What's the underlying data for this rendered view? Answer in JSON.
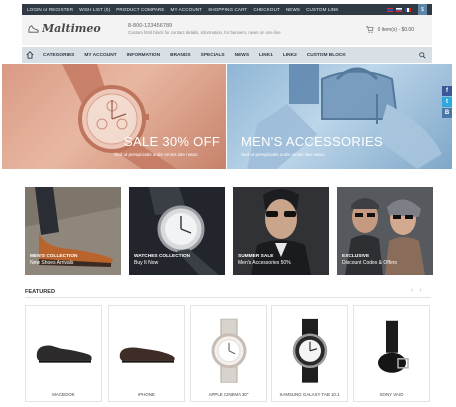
{
  "topbar": {
    "links": [
      "LOGIN or REGISTER",
      "WISH LIST (0)",
      "PRODUCT COMPARE",
      "MY ACCOUNT",
      "SHOPPING CART",
      "CHECKOUT",
      "NEWS",
      "CUSTOM LINK"
    ],
    "currency": "$"
  },
  "header": {
    "logo": "Maltimeo",
    "phone": "8-800-123456789",
    "tagline": "Custom html block for contact details, information, for banners, news on one line",
    "cart": "0 item(s) - $0.00"
  },
  "nav": {
    "items": [
      "CATEGORIES",
      "MY ACCOUNT",
      "INFORMATION",
      "BRANDS",
      "SPECIALS",
      "NEWS",
      "LINK1",
      "LINK2",
      "CUSTOM BLOCK"
    ]
  },
  "banners": [
    {
      "title": "SALE 30% OFF",
      "subtitle": "Sed ut perspiciatis unde omnis iste natus"
    },
    {
      "title": "MEN'S ACCESSORIES",
      "subtitle": "Sed ut perspiciatis unde omnis iste natus"
    }
  ],
  "social": [
    "f",
    "t",
    "B"
  ],
  "tiles": [
    {
      "caption1": "MEN'S COLLECTION",
      "caption2": "New Shoes Arrivals"
    },
    {
      "caption1": "WATCHES COLLECTION",
      "caption2": "Buy It Now"
    },
    {
      "caption1": "SUMMER SALE",
      "caption2": "Men's Accessories 50%"
    },
    {
      "caption1": "EXCLUSIVE",
      "caption2": "Discount Codes & Offers"
    }
  ],
  "featured": {
    "title": "FEATURED",
    "prev": "‹",
    "next": "›",
    "products": [
      "MACBOOK",
      "IPHONE",
      "APPLE CINEMA 30\"",
      "SAMSUNG GALAXY TAB 10.1",
      "SONY VAIO"
    ]
  },
  "colors": {
    "topbar": "#2f3a45",
    "nav": "#d8dfe5",
    "accent": "#5b86a8"
  }
}
